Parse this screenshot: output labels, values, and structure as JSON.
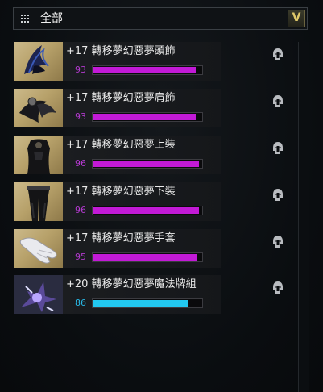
{
  "filter": {
    "label": "全部",
    "grid_icon": "grid-icon",
    "dropdown_icon": "chevron-down-icon"
  },
  "colors": {
    "purple": "#c21ad6",
    "cyan": "#22c8f0",
    "purple_text": "#b43ad0",
    "cyan_text": "#29b8e6"
  },
  "items": [
    {
      "name": "+17 轉移夢幻惡夢頭飾",
      "level": "93",
      "progress": 0.93,
      "type": "purple",
      "icon": "helmet-icon",
      "lock_icon": "helmet-lock-icon"
    },
    {
      "name": "+17 轉移夢幻惡夢肩飾",
      "level": "93",
      "progress": 0.93,
      "type": "purple",
      "icon": "shoulder-icon",
      "lock_icon": "helmet-lock-icon"
    },
    {
      "name": "+17 轉移夢幻惡夢上裝",
      "level": "96",
      "progress": 0.96,
      "type": "purple",
      "icon": "top-armor-icon",
      "lock_icon": "helmet-lock-icon"
    },
    {
      "name": "+17 轉移夢幻惡夢下裝",
      "level": "96",
      "progress": 0.96,
      "type": "purple",
      "icon": "bottom-armor-icon",
      "lock_icon": "helmet-lock-icon"
    },
    {
      "name": "+17 轉移夢幻惡夢手套",
      "level": "95",
      "progress": 0.95,
      "type": "purple",
      "icon": "gloves-icon",
      "lock_icon": "helmet-lock-icon"
    },
    {
      "name": "+20 轉移夢幻惡夢魔法牌組",
      "level": "86",
      "progress": 0.86,
      "type": "cyan",
      "icon": "card-deck-icon",
      "lock_icon": "helmet-lock-icon"
    }
  ]
}
